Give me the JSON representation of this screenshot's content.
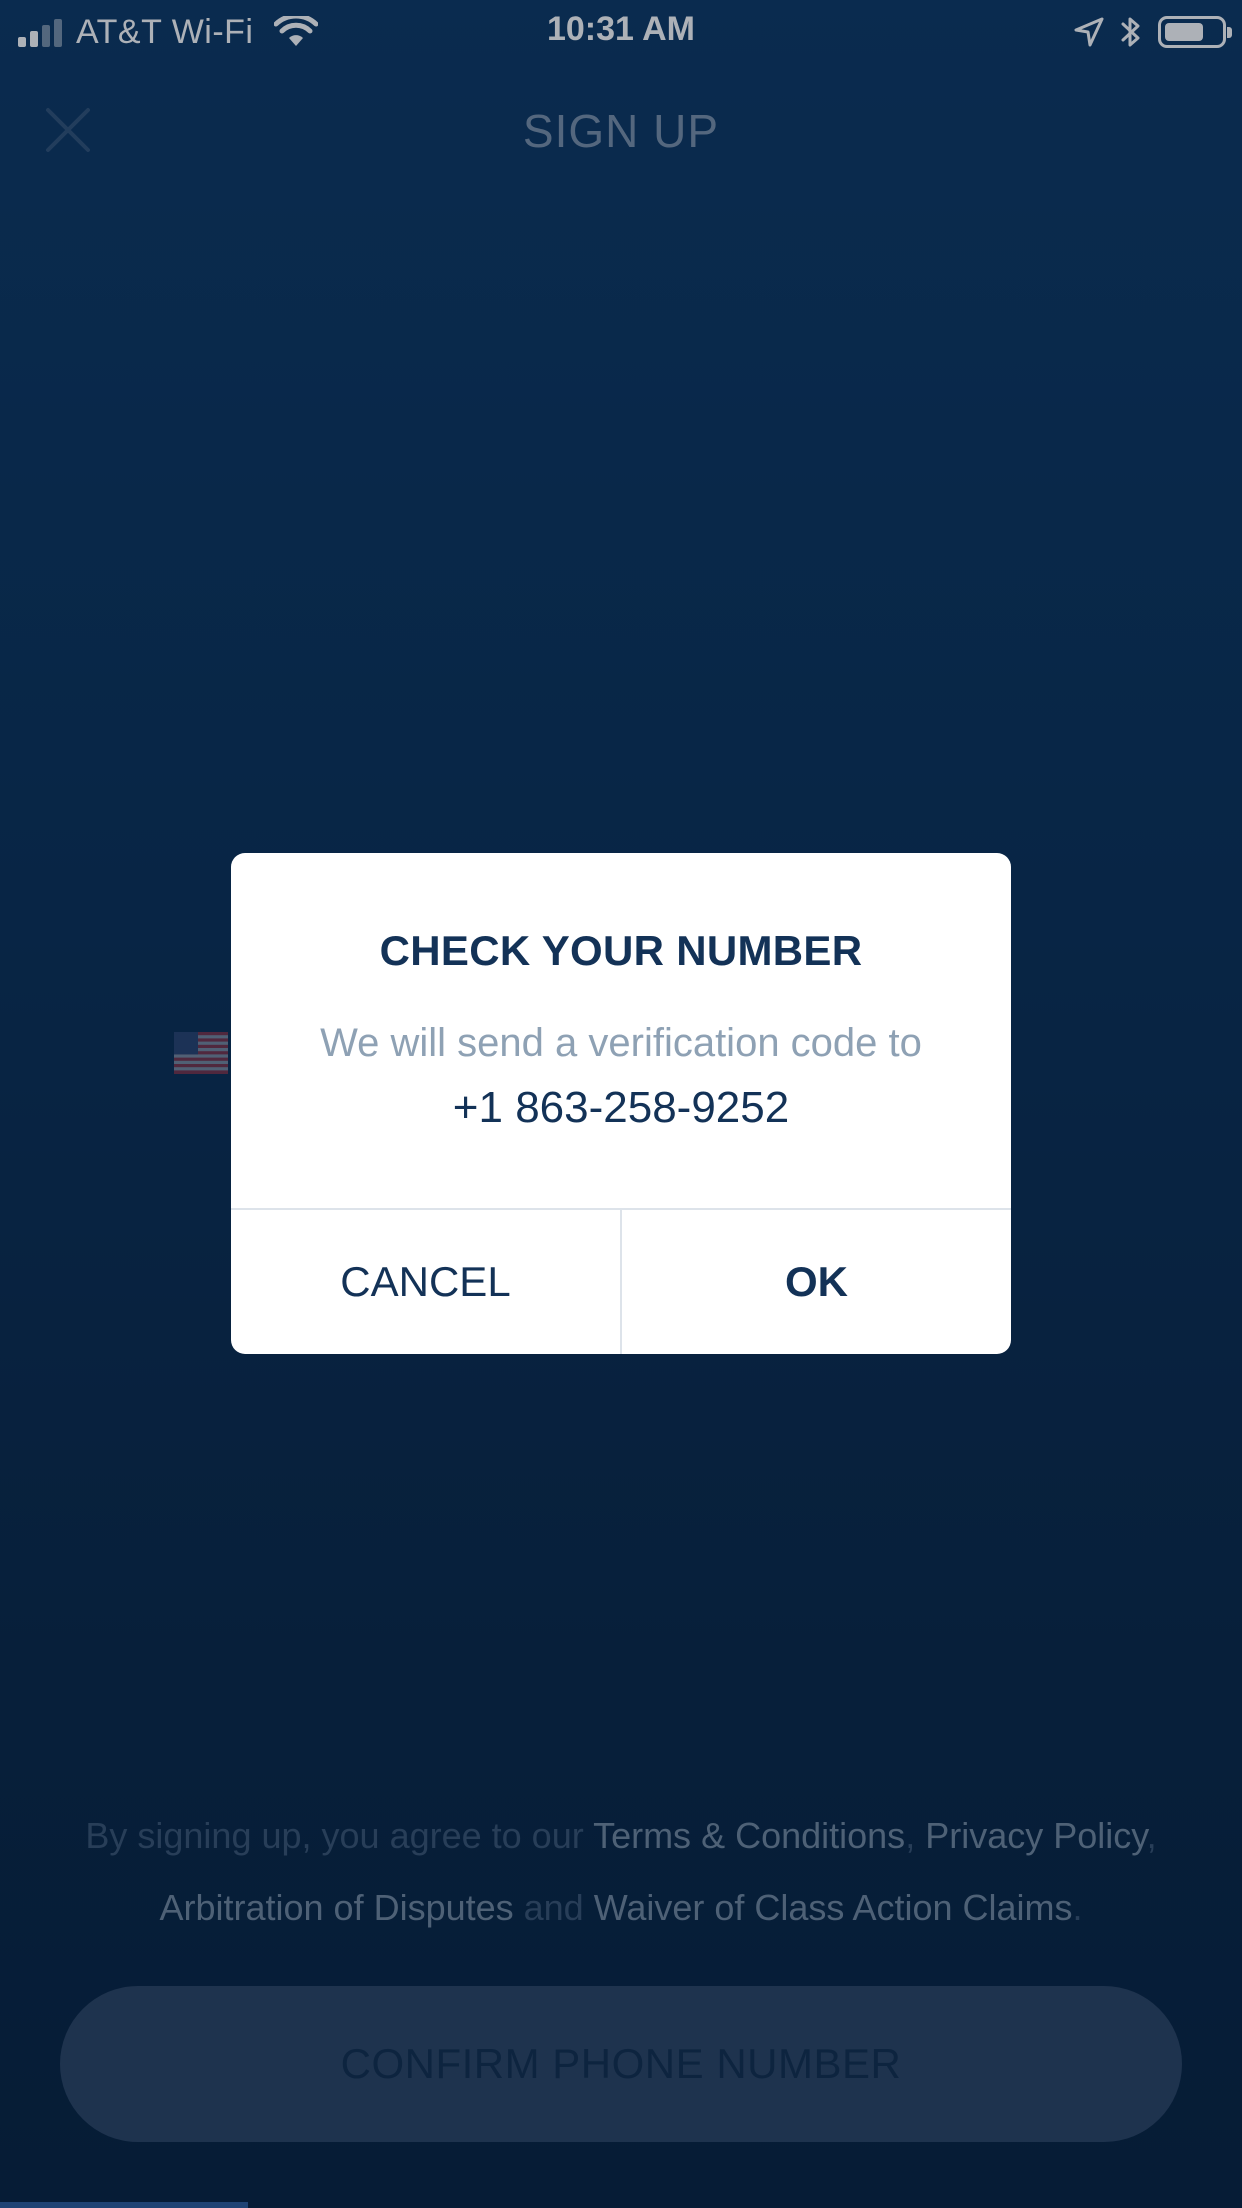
{
  "status_bar": {
    "carrier": "AT&T Wi-Fi",
    "time": "10:31 AM",
    "signal_bars_filled": 2,
    "signal_bars_total": 4,
    "battery_level": 0.7,
    "icons": [
      "wifi-icon",
      "location-arrow-icon",
      "bluetooth-icon",
      "battery-icon"
    ]
  },
  "nav": {
    "title": "SIGN UP",
    "close_icon": "close-icon"
  },
  "form": {
    "country_flag_icon": "us-flag-icon"
  },
  "dialog": {
    "title": "CHECK YOUR NUMBER",
    "message": "We will send a verification code to",
    "phone": "+1 863-258-9252",
    "cancel_label": "CANCEL",
    "ok_label": "OK"
  },
  "legal": {
    "prefix": "By signing up, you agree to our ",
    "terms": "Terms & Conditions",
    "comma1": ", ",
    "privacy": "Privacy Policy",
    "comma2": ", ",
    "arbitration": "Arbitration of Disputes",
    "and": " and ",
    "waiver": "Waiver of Class Action Claims",
    "period": "."
  },
  "confirm_button": {
    "label": "CONFIRM PHONE NUMBER"
  },
  "colors": {
    "background_top": "#0f3a66",
    "background_bottom": "#0a2441",
    "dialog_text": "#133257",
    "dialog_muted": "#8ea1b4",
    "button_bg": "#2d4665"
  }
}
